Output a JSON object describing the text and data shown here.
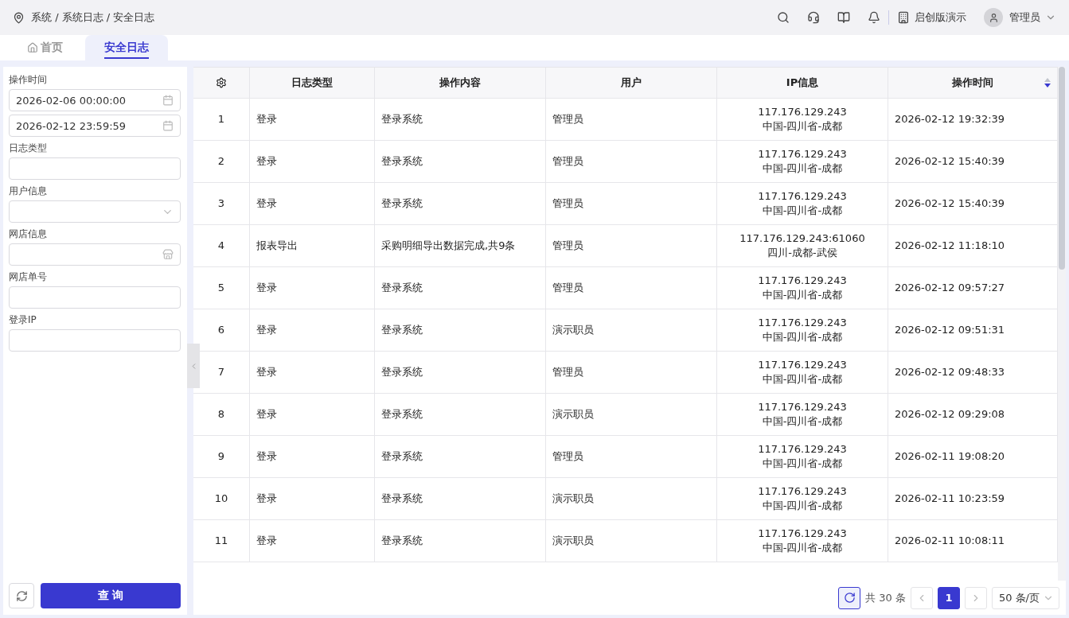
{
  "breadcrumb": "系统 / 系统日志 / 安全日志",
  "header": {
    "org": "启创版演示",
    "user": "管理员"
  },
  "tabs": [
    {
      "label": "首页",
      "kind": "home",
      "selected": false
    },
    {
      "label": "安全日志",
      "kind": "page",
      "selected": true
    }
  ],
  "filters": [
    {
      "label": "操作时间",
      "fields": [
        {
          "kind": "date",
          "value": "2026-02-06 00:00:00"
        },
        {
          "kind": "date",
          "value": "2026-02-12 23:59:59"
        }
      ]
    },
    {
      "label": "日志类型",
      "fields": [
        {
          "kind": "text"
        }
      ]
    },
    {
      "label": "用户信息",
      "fields": [
        {
          "kind": "select"
        }
      ]
    },
    {
      "label": "网店信息",
      "fields": [
        {
          "kind": "store"
        }
      ]
    },
    {
      "label": "网店单号",
      "fields": [
        {
          "kind": "text"
        }
      ]
    },
    {
      "label": "登录IP",
      "fields": [
        {
          "kind": "text"
        }
      ]
    }
  ],
  "query_button": "查 询",
  "table": {
    "columns": [
      {
        "label": "日志类型"
      },
      {
        "label": "操作内容"
      },
      {
        "label": "用户"
      },
      {
        "label": "IP信息"
      },
      {
        "label": "操作时间",
        "sorted_descending": true
      }
    ],
    "rows": [
      {
        "no": "1",
        "type": "登录",
        "content": "登录系统",
        "user": "管理员",
        "ip": "117.176.129.243",
        "location": "中国-四川省-成都",
        "time": "2026-02-12 19:32:39"
      },
      {
        "no": "2",
        "type": "登录",
        "content": "登录系统",
        "user": "管理员",
        "ip": "117.176.129.243",
        "location": "中国-四川省-成都",
        "time": "2026-02-12 15:40:39"
      },
      {
        "no": "3",
        "type": "登录",
        "content": "登录系统",
        "user": "管理员",
        "ip": "117.176.129.243",
        "location": "中国-四川省-成都",
        "time": "2026-02-12 15:40:39"
      },
      {
        "no": "4",
        "type": "报表导出",
        "content": "采购明细导出数据完成,共9条",
        "user": "管理员",
        "ip": "117.176.129.243:61060",
        "location": "四川-成都-武侯",
        "time": "2026-02-12 11:18:10"
      },
      {
        "no": "5",
        "type": "登录",
        "content": "登录系统",
        "user": "管理员",
        "ip": "117.176.129.243",
        "location": "中国-四川省-成都",
        "time": "2026-02-12 09:57:27"
      },
      {
        "no": "6",
        "type": "登录",
        "content": "登录系统",
        "user": "演示职员",
        "ip": "117.176.129.243",
        "location": "中国-四川省-成都",
        "time": "2026-02-12 09:51:31"
      },
      {
        "no": "7",
        "type": "登录",
        "content": "登录系统",
        "user": "管理员",
        "ip": "117.176.129.243",
        "location": "中国-四川省-成都",
        "time": "2026-02-12 09:48:33"
      },
      {
        "no": "8",
        "type": "登录",
        "content": "登录系统",
        "user": "演示职员",
        "ip": "117.176.129.243",
        "location": "中国-四川省-成都",
        "time": "2026-02-12 09:29:08"
      },
      {
        "no": "9",
        "type": "登录",
        "content": "登录系统",
        "user": "管理员",
        "ip": "117.176.129.243",
        "location": "中国-四川省-成都",
        "time": "2026-02-11 19:08:20"
      },
      {
        "no": "10",
        "type": "登录",
        "content": "登录系统",
        "user": "演示职员",
        "ip": "117.176.129.243",
        "location": "中国-四川省-成都",
        "time": "2026-02-11 10:23:59"
      },
      {
        "no": "11",
        "type": "登录",
        "content": "登录系统",
        "user": "演示职员",
        "ip": "117.176.129.243",
        "location": "中国-四川省-成都",
        "time": "2026-02-11 10:08:11"
      }
    ]
  },
  "pagination": {
    "total": "共 30 条",
    "pages": [
      {
        "label": "1",
        "selected": true
      }
    ],
    "page_size": "50 条/页"
  }
}
